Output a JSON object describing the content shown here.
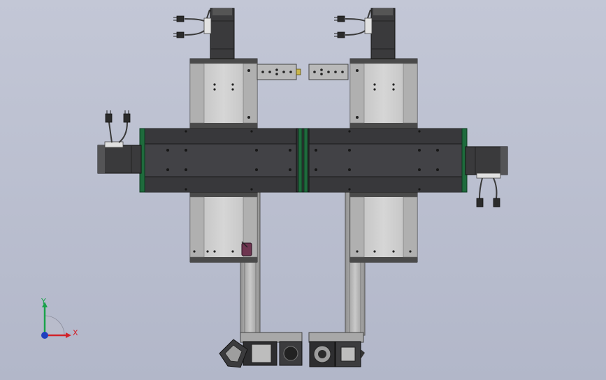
{
  "viewport": {
    "background_top": "#c3c7d6",
    "background_bottom": "#b2b7c9"
  },
  "colors": {
    "beam": "#424246",
    "beam_edge": "#1a1a1a",
    "end_cap": "#1e6b3c",
    "carriage": "#c8c8c8",
    "carriage_dark": "#4a4a4a",
    "column": "#a9a9a9",
    "motor": "#3a3a3c",
    "plate": "#b9b9b9",
    "sensor": "#6e3550"
  },
  "triad": {
    "y_label": "Y",
    "x_label": "X",
    "y_color": "#19a24a",
    "x_color": "#d1232a",
    "z_color": "#1f3fbf"
  },
  "icons": [
    "cable-connector-icon",
    "motor-icon",
    "fastener-hole-icon",
    "axis-triad-icon"
  ]
}
